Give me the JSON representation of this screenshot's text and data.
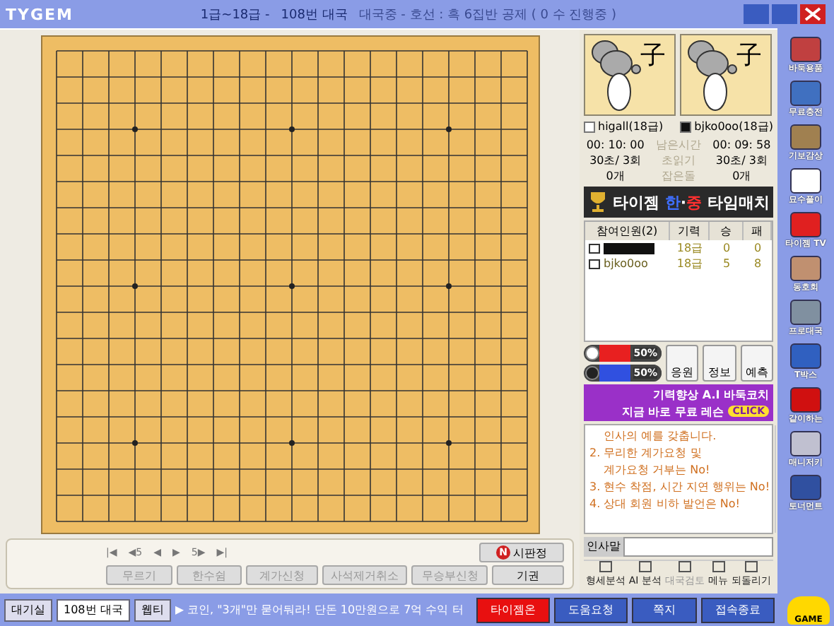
{
  "title_bar": {
    "logo": "TYGEM",
    "rank_range": "1급~18급 -",
    "room": "108번 대국",
    "status": "대국중 - 호선 : 흑 6집반 공제 ( 0 수 진행중 )"
  },
  "controls": {
    "nav": [
      "|◀",
      "◀5",
      "◀",
      "▶",
      "5▶",
      "▶|"
    ],
    "judge": {
      "badge": "N",
      "label": "시판정"
    },
    "buttons": [
      {
        "label": "무르기",
        "disabled": true
      },
      {
        "label": "한수쉼",
        "disabled": true
      },
      {
        "label": "계가신청",
        "disabled": true
      },
      {
        "label": "사석제거취소",
        "disabled": true
      },
      {
        "label": "무승부신청",
        "disabled": true
      },
      {
        "label": "기권",
        "disabled": false
      }
    ]
  },
  "players": [
    {
      "glyph": "子",
      "name": "higall(18급)",
      "kind": "white",
      "clock": "00: 10: 00",
      "byoyomi": "30초/ 3회",
      "captures": "0개"
    },
    {
      "glyph": "子",
      "name": "bjko0oo(18급)",
      "kind": "black",
      "clock": "00: 09: 58",
      "byoyomi": "30초/ 3회",
      "captures": "0개"
    }
  ],
  "clock_labels": [
    "남은시간",
    "초읽기",
    "잡은돌"
  ],
  "banner": {
    "parts": [
      {
        "text": "타이젬 ",
        "color": "#ffffff"
      },
      {
        "text": "한",
        "color": "#3f6fff"
      },
      {
        "text": "·",
        "color": "#ffffff"
      },
      {
        "text": "중",
        "color": "#ff3030"
      },
      {
        "text": " 타임매치",
        "color": "#ffffff"
      }
    ]
  },
  "participants": {
    "columns": [
      "참여인원(2)",
      "기력",
      "승",
      "패"
    ],
    "rows": [
      {
        "name": "",
        "hidden": true,
        "rank": "18급",
        "wins": "0",
        "losses": "0"
      },
      {
        "name": "bjko0oo",
        "hidden": false,
        "rank": "18급",
        "wins": "5",
        "losses": "8"
      }
    ]
  },
  "win_rates": [
    {
      "kind": "white",
      "reading": "50%",
      "level": 0.5,
      "color": "#e82020"
    },
    {
      "kind": "black",
      "reading": "50%",
      "level": 0.5,
      "color": "#3050e0"
    }
  ],
  "side_buttons": [
    "응원",
    "정보",
    "예측"
  ],
  "ad": {
    "headline": "기력향상 A.I 바둑코치",
    "sub": "지금 바로 무료 레슨",
    "cta": "CLICK"
  },
  "chat": {
    "lines": [
      "인사의 예를 갖춥니다.",
      "2. 무리한 계가요청 및",
      "계가요청 거부는 No!",
      "3. 현수 착점, 시간 지연 행위는 No!",
      "4. 상대 회원 비하 발언은 No!"
    ],
    "input_label": "인사말"
  },
  "tools": [
    {
      "label": "형세분석",
      "disabled": false
    },
    {
      "label": "AI 분석",
      "disabled": false
    },
    {
      "label": "대국검토",
      "disabled": true
    },
    {
      "label": "메뉴",
      "disabled": false
    },
    {
      "label": "되돌리기",
      "disabled": false
    }
  ],
  "sidebar": [
    "바둑용품",
    "무료충전",
    "기보감상",
    "묘수풀이",
    "타이젬 TV",
    "동호회",
    "프로대국",
    "T박스",
    "같이하는",
    "매니저키",
    "토너먼트"
  ],
  "status_bar": {
    "tabs": [
      {
        "label": "대기실",
        "selected": false
      },
      {
        "label": "108번 대국",
        "selected": true
      },
      {
        "label": "웹티",
        "selected": false
      }
    ],
    "ticker": "▶ 코인, \"3개\"만 묻어둬라! 단돈 10만원으로 7억 수익 터",
    "buttons": [
      {
        "label": "타이젬온",
        "kind": "alert"
      },
      {
        "label": "도움요청",
        "kind": "normal"
      },
      {
        "label": "쪽지",
        "kind": "normal"
      },
      {
        "label": "접속종료",
        "kind": "normal"
      }
    ],
    "game_label": "GAME"
  }
}
